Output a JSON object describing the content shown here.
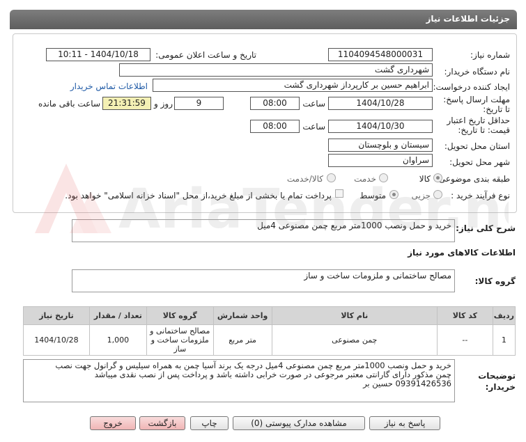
{
  "header": {
    "title": "جزئیات اطلاعات نیاز"
  },
  "form": {
    "need_number_label": "شماره نیاز:",
    "need_number": "1104094548000031",
    "announce_label": "تاریخ و ساعت اعلان عمومی:",
    "announce_value": "1404/10/18 - 10:11",
    "buyer_org_label": "نام دستگاه خریدار:",
    "buyer_org": "شهرداری گشت",
    "creator_label": "ایجاد کننده درخواست:",
    "creator": "ابراهیم حسین بر کارپرداز شهرداری گشت",
    "contact_link": "اطلاعات تماس خریدار",
    "deadline_label": "مهلت ارسال پاسخ: تا تاریخ:",
    "deadline_date": "1404/10/28",
    "time_label": "ساعت",
    "deadline_time": "08:00",
    "days_value": "9",
    "days_label": "روز و",
    "remaining_value": "21:31:59",
    "remaining_label": "ساعت باقی مانده",
    "validity_label": "حداقل تاریخ اعتبار قیمت: تا تاریخ:",
    "validity_date": "1404/10/30",
    "validity_time": "08:00",
    "province_label": "استان محل تحویل:",
    "province": "سیستان و بلوچستان",
    "city_label": "شهر محل تحویل:",
    "city": "سراوان",
    "category_label": "طبقه بندی موضوعی:",
    "category_options": [
      "کالا",
      "خدمت",
      "کالا/خدمت"
    ],
    "process_label": "نوع فرآیند خرید :",
    "process_options": [
      "جزیی",
      "متوسط"
    ],
    "payment_note": "پرداخت تمام یا بخشی از مبلغ خرید،از محل \"اسناد خزانه اسلامی\" خواهد بود."
  },
  "summary": {
    "label": "شرح کلی نیاز:",
    "text": "خرید و حمل ونصب 1000متر مربع چمن مصنوعی 4میل"
  },
  "goods": {
    "section_title": "اطلاعات کالاهای مورد نیاز",
    "group_label": "گروه کالا:",
    "group_value": "مصالح ساختمانی و ملزومات ساخت و ساز"
  },
  "table": {
    "headers": [
      "ردیف",
      "کد کالا",
      "نام کالا",
      "واحد شمارش",
      "گروه کالا",
      "تعداد / مقدار",
      "تاریخ نیاز"
    ],
    "rows": [
      [
        "1",
        "--",
        "چمن مصنوعی",
        "متر مربع",
        "مصالح ساختمانی و ملزومات ساخت و ساز",
        "1,000",
        "1404/10/28"
      ]
    ]
  },
  "buyer_notes": {
    "label": "توضیحات خریدار:",
    "line1": "خرید و حمل ونصب 1000متر مربع چمن مصنوعی 4میل درجه یک برند آسیا چمن به همراه سیلیس و گرانول جهت نصب",
    "line2": "چمن مذکور دارای گارانتی معتبر مرجوعی در صورت خرابی داشته باشد و پرداخت پس از نصب نقدی میباشد",
    "line3": "09391426536 حسین بر"
  },
  "buttons": {
    "reply": "پاسخ به نیاز",
    "docs": "مشاهده مدارک پیوستی (0)",
    "print": "چاپ",
    "back": "بازگشت",
    "exit": "خروج"
  },
  "watermark": {
    "text": "AriaTender.net"
  }
}
